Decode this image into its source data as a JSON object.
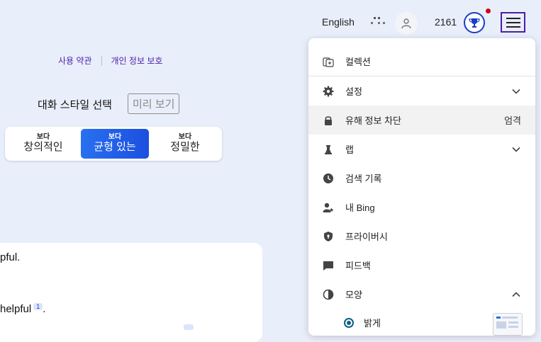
{
  "topbar": {
    "language": "English",
    "points": "2161"
  },
  "links": {
    "terms": "사용 약관",
    "privacy": "개인 정보 보호"
  },
  "style_select": {
    "title": "대화 스타일 선택",
    "preview_badge": "미리 보기",
    "options": [
      {
        "small": "보다",
        "big": "창의적인",
        "active": false
      },
      {
        "small": "보다",
        "big": "균형 있는",
        "active": true
      },
      {
        "small": "보다",
        "big": "정밀한",
        "active": false
      }
    ]
  },
  "chat": {
    "line1": "pful.",
    "line2": "helpful",
    "line2_cite": "1",
    "line2_end": "."
  },
  "menu": {
    "items": [
      {
        "label": "컬렉션",
        "icon": "collection-icon"
      },
      {
        "label": "설정",
        "icon": "gear-icon",
        "chevron": "down"
      },
      {
        "label": "유해 정보 차단",
        "icon": "lock-icon",
        "value": "엄격"
      },
      {
        "label": "랩",
        "icon": "labs-icon",
        "chevron": "down"
      },
      {
        "label": "검색 기록",
        "icon": "history-icon"
      },
      {
        "label": "내 Bing",
        "icon": "my-bing-icon"
      },
      {
        "label": "프라이버시",
        "icon": "shield-icon"
      },
      {
        "label": "피드백",
        "icon": "feedback-icon"
      },
      {
        "label": "모양",
        "icon": "appearance-icon",
        "chevron": "up"
      },
      {
        "label": "밝게",
        "icon": "radio-selected"
      }
    ]
  },
  "colors": {
    "accent": "#1b4fe0",
    "menu_button_border": "#4b1fa6",
    "notification": "#d0021b"
  }
}
